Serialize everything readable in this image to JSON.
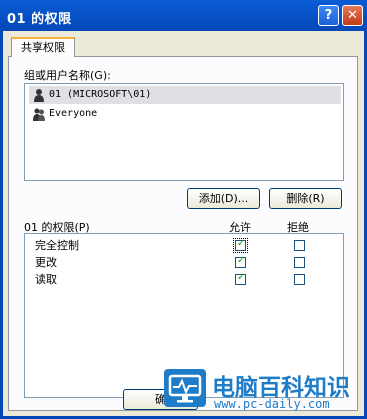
{
  "window": {
    "title": "01 的权限",
    "help_glyph": "?",
    "close_glyph": "✕"
  },
  "tab": {
    "label": "共享权限"
  },
  "users_section": {
    "label": "组或用户名称(G):",
    "items": [
      {
        "label": "01 (MICROSOFT\\01)",
        "selected": true
      },
      {
        "label": "Everyone",
        "selected": false
      }
    ]
  },
  "buttons": {
    "add": "添加(D)...",
    "remove": "删除(R)",
    "ok": "确"
  },
  "permissions": {
    "header": "01 的权限(P)",
    "allow": "允许",
    "deny": "拒绝",
    "rows": [
      {
        "name": "完全控制",
        "allow": true,
        "deny": false
      },
      {
        "name": "更改",
        "allow": true,
        "deny": false
      },
      {
        "name": "读取",
        "allow": true,
        "deny": false
      }
    ]
  },
  "watermark": {
    "title": "电脑百科知识",
    "url": "www.pc-daily.com"
  },
  "colors": {
    "titlebar": "#0548b8",
    "check": "#21a121",
    "watermark": "#1f7cc9"
  }
}
